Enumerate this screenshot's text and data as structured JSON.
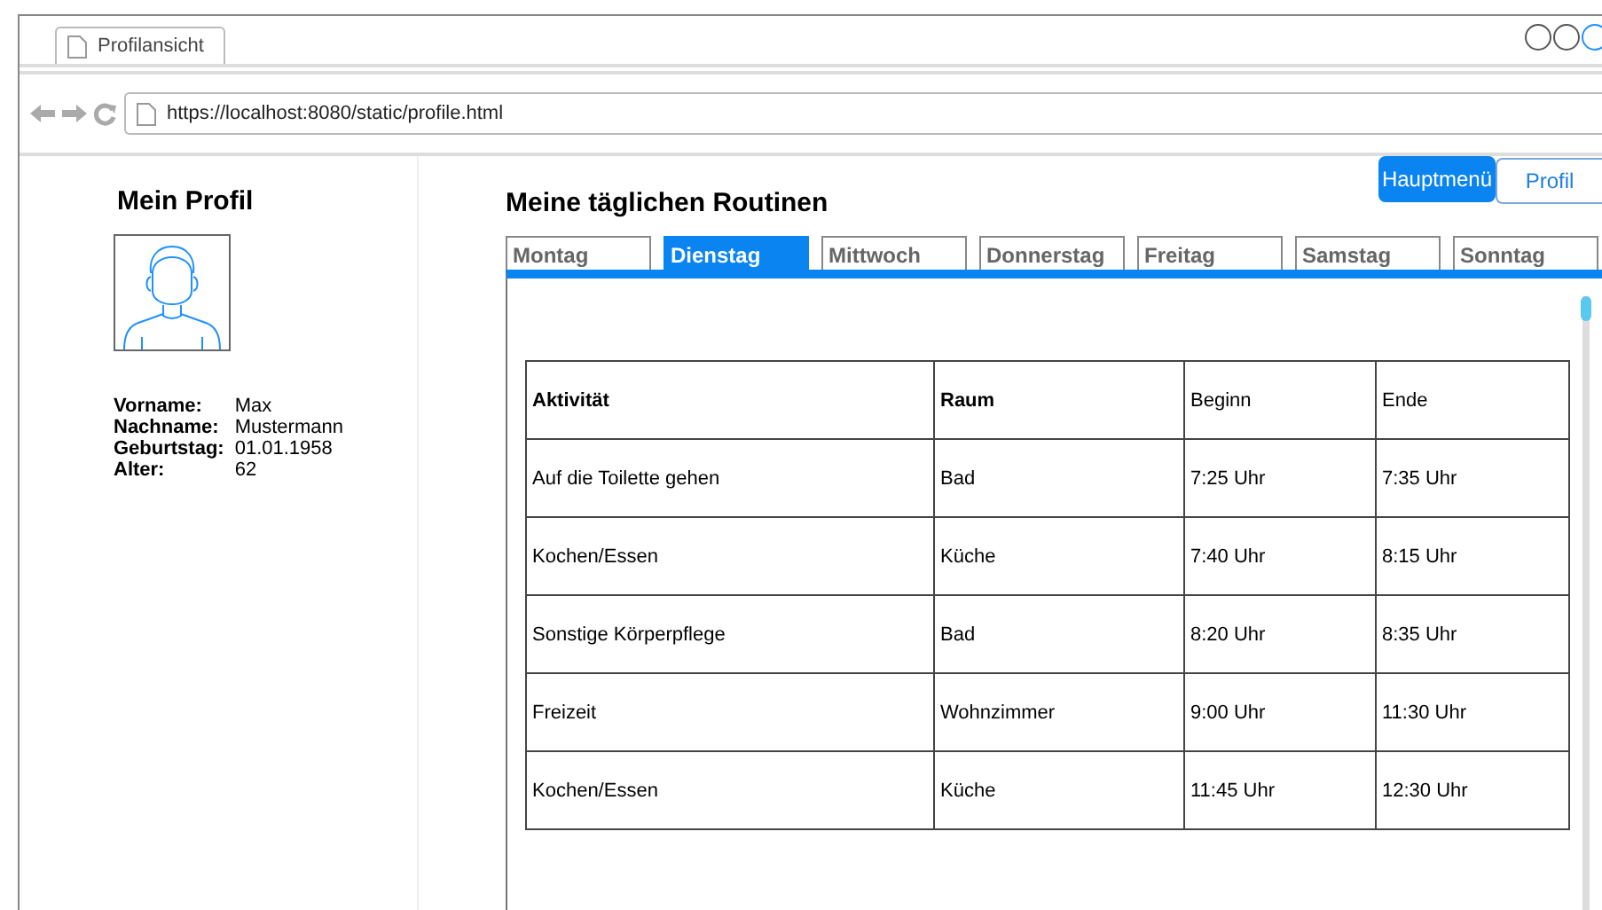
{
  "browser": {
    "tab_title": "Profilansicht",
    "url": "https://localhost:8080/static/profile.html"
  },
  "nav_buttons": [
    {
      "label": "Hauptmenü",
      "kind": "primary"
    },
    {
      "label": "Profil",
      "kind": "secondary"
    }
  ],
  "profile": {
    "title": "Mein Profil",
    "fields": [
      {
        "label": "Vorname:",
        "value": "Max"
      },
      {
        "label": "Nachname:",
        "value": "Mustermann"
      },
      {
        "label": "Geburtstag:",
        "value": "01.01.1958"
      },
      {
        "label": "Alter:",
        "value": "62"
      }
    ]
  },
  "routines": {
    "title": "Meine täglichen Routinen",
    "tabs": [
      {
        "label": "Montag",
        "selected": false
      },
      {
        "label": "Dienstag",
        "selected": true
      },
      {
        "label": "Mittwoch",
        "selected": false
      },
      {
        "label": "Donnerstag",
        "selected": false
      },
      {
        "label": "Freitag",
        "selected": false
      },
      {
        "label": "Samstag",
        "selected": false
      },
      {
        "label": "Sonntag",
        "selected": false
      }
    ],
    "table": {
      "columns": [
        {
          "label": "Aktivität",
          "bold": true
        },
        {
          "label": "Raum",
          "bold": true
        },
        {
          "label": "Beginn",
          "bold": false
        },
        {
          "label": "Ende",
          "bold": false
        }
      ],
      "rows": [
        [
          "Auf die Toilette gehen",
          "Bad",
          "7:25 Uhr",
          "7:35 Uhr"
        ],
        [
          "Kochen/Essen",
          "Küche",
          "7:40 Uhr",
          "8:15 Uhr"
        ],
        [
          "Sonstige Körperpflege",
          "Bad",
          "8:20 Uhr",
          "8:35 Uhr"
        ],
        [
          "Freizeit",
          "Wohnzimmer",
          "9:00 Uhr",
          "11:30 Uhr"
        ],
        [
          "Kochen/Essen",
          "Küche",
          "11:45 Uhr",
          "12:30 Uhr"
        ]
      ]
    }
  }
}
